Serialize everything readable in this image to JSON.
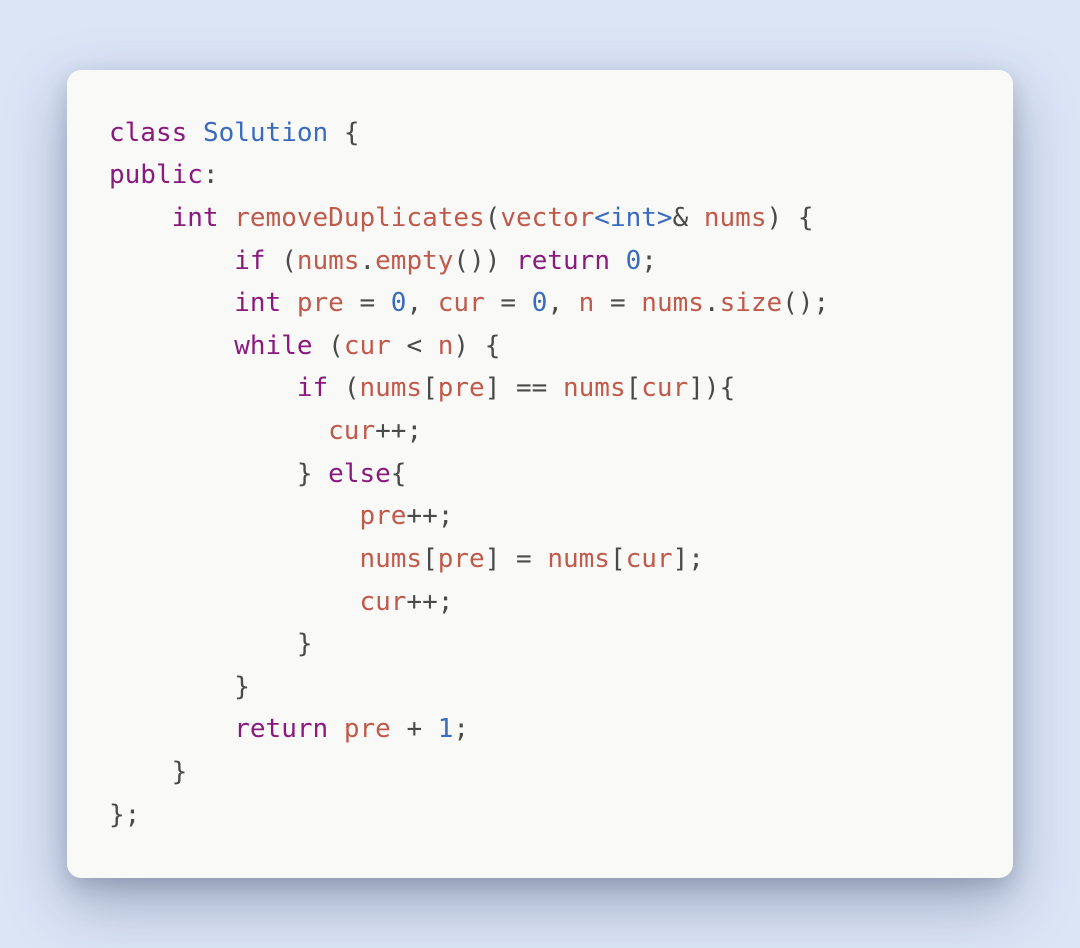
{
  "language": "cpp",
  "tokens": {
    "class": "class",
    "Solution": "Solution",
    "public": "public",
    "int": "int",
    "fn_removeDuplicates": "removeDuplicates",
    "vector": "vector",
    "tpl_int": "int",
    "amp": "&",
    "nums": "nums",
    "if": "if",
    "empty": "empty",
    "return": "return",
    "zero": "0",
    "pre": "pre",
    "cur": "cur",
    "n": "n",
    "size": "size",
    "while": "while",
    "lt": "<",
    "gt": ">",
    "eqeq": "==",
    "eq": "=",
    "plusplus": "++",
    "plus": "+",
    "one": "1",
    "else": "else",
    "lbrace": "{",
    "rbrace": "}",
    "lparen": "(",
    "rparen": ")",
    "lbracket": "[",
    "rbracket": "]",
    "comma": ",",
    "semi": ";",
    "colon": ":",
    "dot": "."
  },
  "plain_source": "class Solution {\npublic:\n    int removeDuplicates(vector<int>& nums) {\n        if (nums.empty()) return 0;\n        int pre = 0, cur = 0, n = nums.size();\n        while (cur < n) {\n            if (nums[pre] == nums[cur]){\n              cur++;\n            } else{\n                pre++;\n                nums[pre] = nums[cur];\n                cur++;\n            }\n        }\n        return pre + 1;\n    }\n};"
}
